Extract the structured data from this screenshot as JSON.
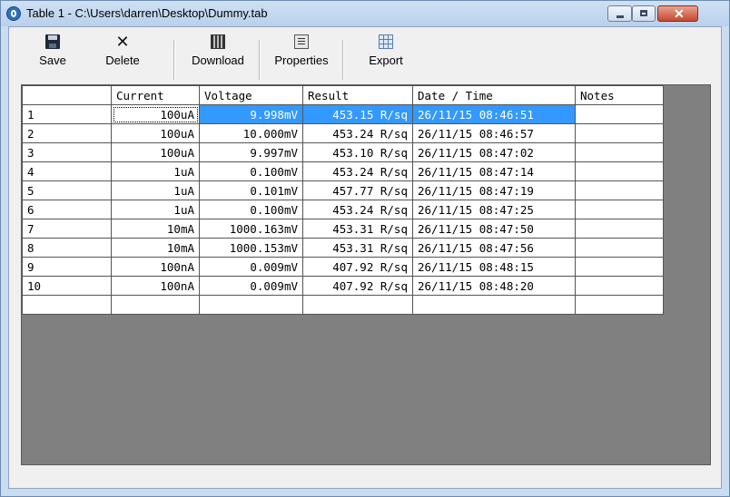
{
  "window": {
    "title": "Table 1 - C:\\Users\\darren\\Desktop\\Dummy.tab",
    "icon": "app-logo-icon",
    "controls": [
      "minimize-icon",
      "maximize-icon",
      "close-icon"
    ],
    "close_glyph": "✕"
  },
  "toolbar": {
    "save_label": "Save",
    "delete_label": "Delete",
    "delete_glyph": "✕",
    "download_label": "Download",
    "properties_label": "Properties",
    "export_label": "Export"
  },
  "table": {
    "headers": [
      "",
      "Current",
      "Voltage",
      "Result",
      "Date / Time",
      "Notes"
    ],
    "rows": [
      {
        "idx": "1",
        "current": "100uA",
        "voltage": "9.998mV",
        "result": "453.15 R/sq",
        "datetime": "26/11/15 08:46:51",
        "notes": ""
      },
      {
        "idx": "2",
        "current": "100uA",
        "voltage": "10.000mV",
        "result": "453.24 R/sq",
        "datetime": "26/11/15 08:46:57",
        "notes": ""
      },
      {
        "idx": "3",
        "current": "100uA",
        "voltage": "9.997mV",
        "result": "453.10 R/sq",
        "datetime": "26/11/15 08:47:02",
        "notes": ""
      },
      {
        "idx": "4",
        "current": "1uA",
        "voltage": "0.100mV",
        "result": "453.24 R/sq",
        "datetime": "26/11/15 08:47:14",
        "notes": ""
      },
      {
        "idx": "5",
        "current": "1uA",
        "voltage": "0.101mV",
        "result": "457.77 R/sq",
        "datetime": "26/11/15 08:47:19",
        "notes": ""
      },
      {
        "idx": "6",
        "current": "1uA",
        "voltage": "0.100mV",
        "result": "453.24 R/sq",
        "datetime": "26/11/15 08:47:25",
        "notes": ""
      },
      {
        "idx": "7",
        "current": "10mA",
        "voltage": "1000.163mV",
        "result": "453.31 R/sq",
        "datetime": "26/11/15 08:47:50",
        "notes": ""
      },
      {
        "idx": "8",
        "current": "10mA",
        "voltage": "1000.153mV",
        "result": "453.31 R/sq",
        "datetime": "26/11/15 08:47:56",
        "notes": ""
      },
      {
        "idx": "9",
        "current": "100nA",
        "voltage": "0.009mV",
        "result": "407.92 R/sq",
        "datetime": "26/11/15 08:48:15",
        "notes": ""
      },
      {
        "idx": "10",
        "current": "100nA",
        "voltage": "0.009mV",
        "result": "407.92 R/sq",
        "datetime": "26/11/15 08:48:20",
        "notes": ""
      },
      {
        "idx": "",
        "current": "",
        "voltage": "",
        "result": "",
        "datetime": "",
        "notes": ""
      }
    ],
    "selected_row": 0
  },
  "colors": {
    "selection": "#3399ff",
    "grid_background": "#808080",
    "title_bar": "#c9dcf0"
  }
}
